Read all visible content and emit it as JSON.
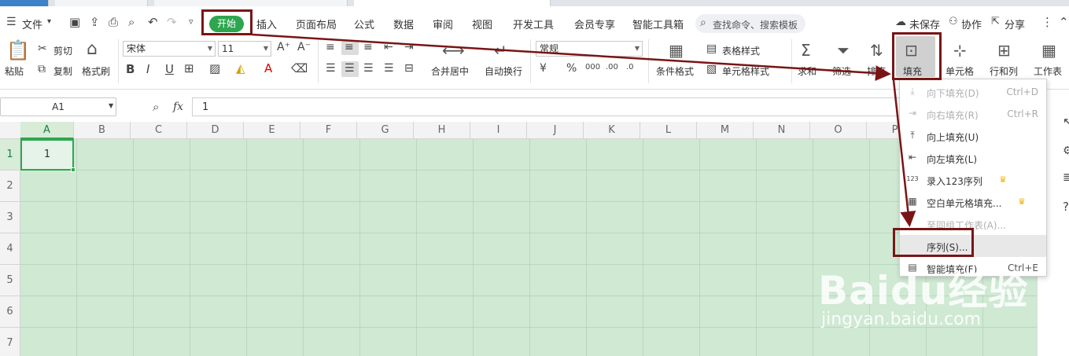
{
  "menu": {
    "file": "文件",
    "tabs": [
      "开始",
      "插入",
      "页面布局",
      "公式",
      "数据",
      "审阅",
      "视图",
      "开发工具",
      "会员专享",
      "智能工具箱"
    ],
    "search_placeholder": "查找命令、搜索模板",
    "unsaved": "未保存",
    "collab": "协作",
    "share": "分享"
  },
  "ribbon": {
    "paste": "粘贴",
    "cut": "剪切",
    "copy": "复制",
    "format_painter": "格式刷",
    "font_name": "宋体",
    "font_size": "11",
    "merge_center": "合并居中",
    "wrap_text": "自动换行",
    "number_format": "常规",
    "cond_format": "条件格式",
    "table_style": "表格样式",
    "cell_style": "单元格样式",
    "sum": "求和",
    "filter": "筛选",
    "sort": "排序",
    "fill": "填充",
    "cell": "单元格",
    "row_col": "行和列",
    "worksheet": "工作表"
  },
  "formula_bar": {
    "name_box": "A1",
    "fx": "fx",
    "value": "1"
  },
  "sheet": {
    "columns": [
      "A",
      "B",
      "C",
      "D",
      "E",
      "F",
      "G",
      "H",
      "I",
      "J",
      "K",
      "L",
      "M",
      "N",
      "O",
      "P"
    ],
    "rows": [
      "1",
      "2",
      "3",
      "4",
      "5",
      "6",
      "7"
    ],
    "a1_value": "1"
  },
  "fill_menu": {
    "items": [
      {
        "label": "向下填充(D)",
        "shortcut": "Ctrl+D",
        "icon": "fill-down-icon"
      },
      {
        "label": "向右填充(R)",
        "shortcut": "Ctrl+R",
        "icon": "fill-right-icon"
      },
      {
        "label": "向上填充(U)",
        "shortcut": "",
        "icon": "fill-up-icon"
      },
      {
        "label": "向左填充(L)",
        "shortcut": "",
        "icon": "fill-left-icon"
      },
      {
        "label": "录入123序列",
        "shortcut": "",
        "icon": "series-123-icon"
      },
      {
        "label": "空白单元格填充...",
        "shortcut": "",
        "icon": "blank-fill-icon"
      },
      {
        "label": "至同组工作表(A)...",
        "shortcut": "",
        "icon": ""
      },
      {
        "label": "序列(S)...",
        "shortcut": "",
        "icon": ""
      },
      {
        "label": "智能填充(F)",
        "shortcut": "Ctrl+E",
        "icon": "smart-fill-icon"
      }
    ]
  },
  "watermark": {
    "brand": "Baidu经验",
    "url": "jingyan.baidu.com"
  },
  "colors": {
    "accent_green": "#2ea64f",
    "highlight_box": "#7a1515",
    "sheet_bg": "#cfe9d3"
  }
}
